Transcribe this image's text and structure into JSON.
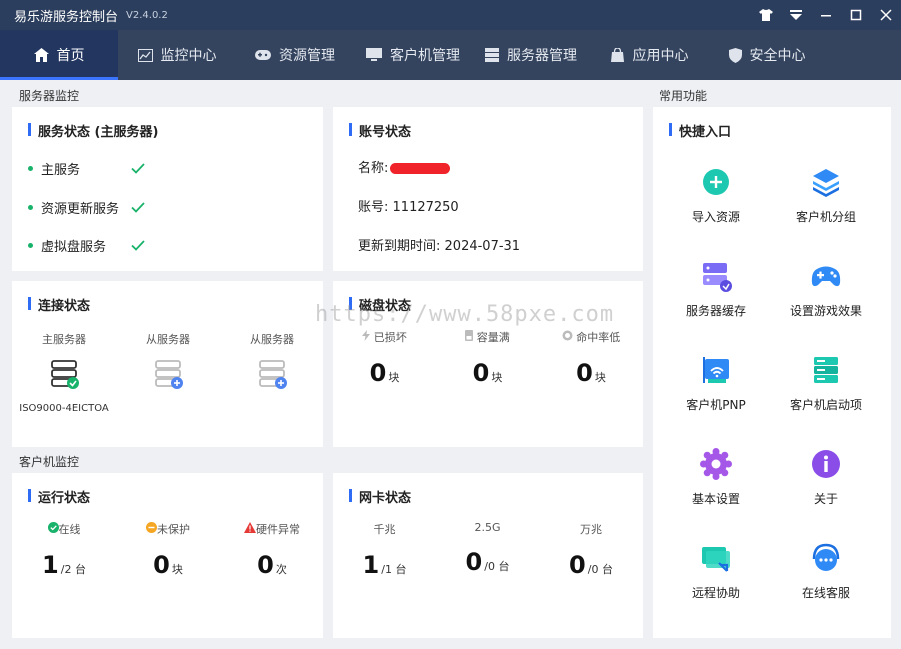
{
  "window": {
    "title": "易乐游服务控制台",
    "version": "V2.4.0.2"
  },
  "nav": {
    "tabs": [
      {
        "label": "首页"
      },
      {
        "label": "监控中心"
      },
      {
        "label": "资源管理"
      },
      {
        "label": "客户机管理"
      },
      {
        "label": "服务器管理"
      },
      {
        "label": "应用中心"
      },
      {
        "label": "安全中心"
      }
    ]
  },
  "server_monitor": {
    "label": "服务器监控",
    "service_status": {
      "title": "服务状态 (主服务器)",
      "items": [
        "主服务",
        "资源更新服务",
        "虚拟盘服务"
      ]
    },
    "account": {
      "title": "账号状态",
      "name_label": "名称:",
      "account_label": "账号:",
      "account_value": "11127250",
      "expire_label": "更新到期时间:",
      "expire_value": "2024-07-31"
    },
    "connection": {
      "title": "连接状态",
      "servers": [
        {
          "label": "主服务器",
          "id": "ISO9000-4EICTOA"
        },
        {
          "label": "从服务器"
        },
        {
          "label": "从服务器"
        }
      ]
    },
    "disk": {
      "title": "磁盘状态",
      "cols": [
        {
          "label": "已损坏",
          "value": "0",
          "unit": "块"
        },
        {
          "label": "容量满",
          "value": "0",
          "unit": "块"
        },
        {
          "label": "命中率低",
          "value": "0",
          "unit": "块"
        }
      ]
    }
  },
  "client_monitor": {
    "label": "客户机监控",
    "run": {
      "title": "运行状态",
      "cols": [
        {
          "label": "在线",
          "value": "1",
          "unit": "/2 台",
          "color": "#18b26a"
        },
        {
          "label": "未保护",
          "value": "0",
          "unit": "块",
          "color": "#f5a623"
        },
        {
          "label": "硬件异常",
          "value": "0",
          "unit": "次",
          "color": "#e53935"
        }
      ]
    },
    "nic": {
      "title": "网卡状态",
      "cols": [
        {
          "label": "千兆",
          "value": "1",
          "unit": "/1 台"
        },
        {
          "label": "2.5G",
          "value": "0",
          "unit": "/0 台"
        },
        {
          "label": "万兆",
          "value": "0",
          "unit": "/0 台"
        }
      ]
    }
  },
  "common": {
    "label": "常用功能",
    "quick_title": "快捷入口",
    "items": [
      {
        "label": "导入资源",
        "icon": "plus-circle-icon"
      },
      {
        "label": "客户机分组",
        "icon": "layers-icon"
      },
      {
        "label": "服务器缓存",
        "icon": "server-cache-icon"
      },
      {
        "label": "设置游戏效果",
        "icon": "gamepad-icon"
      },
      {
        "label": "客户机PNP",
        "icon": "network-card-icon"
      },
      {
        "label": "客户机启动项",
        "icon": "server-rack-icon"
      },
      {
        "label": "基本设置",
        "icon": "gear-icon"
      },
      {
        "label": "关于",
        "icon": "info-icon"
      },
      {
        "label": "远程协助",
        "icon": "remote-screen-icon"
      },
      {
        "label": "在线客服",
        "icon": "headset-icon"
      }
    ]
  },
  "watermark": "https://www.58pxe.com"
}
